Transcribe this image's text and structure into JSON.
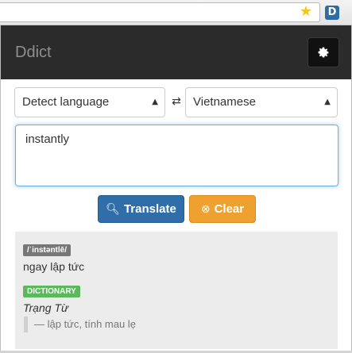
{
  "browser": {
    "star_icon": "star-icon",
    "extension_icon_label": "D"
  },
  "header": {
    "title": "Ddict",
    "settings_icon": "gear-icon"
  },
  "languages": {
    "source": "Detect language",
    "target": "Vietnamese",
    "swap_icon": "swap-arrows-icon"
  },
  "input": {
    "value": "instantly"
  },
  "buttons": {
    "translate_label": "Translate",
    "clear_label": "Clear"
  },
  "result": {
    "phonetic": "/ˈinstəntlē/",
    "primary_meaning": "ngay lập tức",
    "dictionary_badge": "DICTIONARY",
    "word_type": "Trạng Từ",
    "senses": "— lập tức, tính mau lẹ"
  },
  "colors": {
    "header_bg": "#2b2b2b",
    "translate_button": "#2f6ea8",
    "clear_button": "#efa12f",
    "dictionary_badge": "#5cb85c",
    "phonetic_badge": "#777777"
  }
}
